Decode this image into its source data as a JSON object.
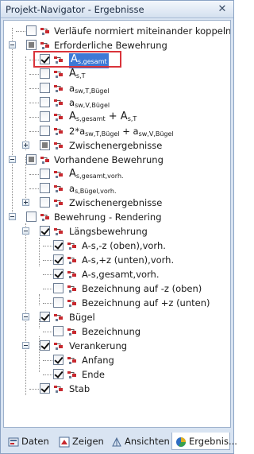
{
  "panel": {
    "title": "Projekt-Navigator - Ergebnisse",
    "close_glyph": "✕"
  },
  "tree": [
    {
      "id": "r0",
      "label": "Verläufe normiert miteinander koppeln",
      "state": "unchecked",
      "icon": "result-icon"
    },
    {
      "id": "r1",
      "label": "Erforderliche Bewehrung",
      "state": "partial",
      "icon": "result-icon",
      "expander": "minus"
    },
    {
      "id": "r2",
      "label": "A",
      "sub": "s,gesamt",
      "state": "checked",
      "icon": "result-icon",
      "selected": true
    },
    {
      "id": "r3",
      "label": "A",
      "sub": "s,T",
      "state": "unchecked",
      "icon": "result-icon"
    },
    {
      "id": "r4",
      "label": "a",
      "sub": "sw,T,Bügel",
      "state": "unchecked",
      "icon": "result-icon"
    },
    {
      "id": "r5",
      "label": "a",
      "sub": "sw,V,Bügel",
      "state": "unchecked",
      "icon": "result-icon"
    },
    {
      "id": "r6",
      "label": "A",
      "sub": "s,gesamt",
      "suffix": " + A",
      "sub2": "s,T",
      "state": "unchecked",
      "icon": "result-icon"
    },
    {
      "id": "r7",
      "label": "2*a",
      "sub": "sw,T,Bügel",
      "suffix": " + a",
      "sub2": "sw,V,Bügel",
      "state": "unchecked",
      "icon": "result-icon"
    },
    {
      "id": "r8",
      "label": "Zwischenergebnisse",
      "state": "partial",
      "icon": "result-icon",
      "expander": "plus"
    },
    {
      "id": "r9",
      "label": "Vorhandene Bewehrung",
      "state": "partial",
      "icon": "result-icon",
      "expander": "minus"
    },
    {
      "id": "r10",
      "label": "A",
      "sub": "s,gesamt,vorh.",
      "state": "unchecked",
      "icon": "result-icon"
    },
    {
      "id": "r11",
      "label": "a",
      "sub": "s,Bügel,vorh.",
      "state": "unchecked",
      "icon": "result-icon"
    },
    {
      "id": "r12",
      "label": "Zwischenergebnisse",
      "state": "unchecked",
      "icon": "result-icon",
      "expander": "plus"
    },
    {
      "id": "r13",
      "label": "Bewehrung - Rendering",
      "state": "unchecked",
      "icon": "result-icon",
      "expander": "minus"
    },
    {
      "id": "r14",
      "label": "Längsbewehrung",
      "state": "checked",
      "icon": "result-icon",
      "expander": "minus"
    },
    {
      "id": "r15",
      "label": "A-s,-z (oben),vorh.",
      "state": "checked",
      "icon": "result-icon"
    },
    {
      "id": "r16",
      "label": "A-s,+z (unten),vorh.",
      "state": "checked",
      "icon": "result-icon"
    },
    {
      "id": "r17",
      "label": "A-s,gesamt,vorh.",
      "state": "checked",
      "icon": "result-icon"
    },
    {
      "id": "r18",
      "label": "Bezeichnung auf -z (oben)",
      "state": "unchecked",
      "icon": "result-icon"
    },
    {
      "id": "r19",
      "label": "Bezeichnung auf +z (unten)",
      "state": "unchecked",
      "icon": "result-icon"
    },
    {
      "id": "r20",
      "label": "Bügel",
      "state": "checked",
      "icon": "result-icon",
      "expander": "minus"
    },
    {
      "id": "r21",
      "label": "Bezeichnung",
      "state": "unchecked",
      "icon": "result-icon"
    },
    {
      "id": "r22",
      "label": "Verankerung",
      "state": "checked",
      "icon": "result-icon",
      "expander": "minus"
    },
    {
      "id": "r23",
      "label": "Anfang",
      "state": "checked",
      "icon": "result-icon"
    },
    {
      "id": "r24",
      "label": "Ende",
      "state": "checked",
      "icon": "result-icon"
    },
    {
      "id": "r25",
      "label": "Stab",
      "state": "checked",
      "icon": "result-icon"
    }
  ],
  "tabs": [
    {
      "label": "Daten",
      "icon": "data-icon"
    },
    {
      "label": "Zeigen",
      "icon": "display-icon"
    },
    {
      "label": "Ansichten",
      "icon": "views-icon"
    },
    {
      "label": "Ergebnis...",
      "icon": "results-icon",
      "active": true
    }
  ],
  "colors": {
    "selection": "#3d79d6",
    "highlight_frame": "#d9333a",
    "icon_red": "#c8282e"
  }
}
